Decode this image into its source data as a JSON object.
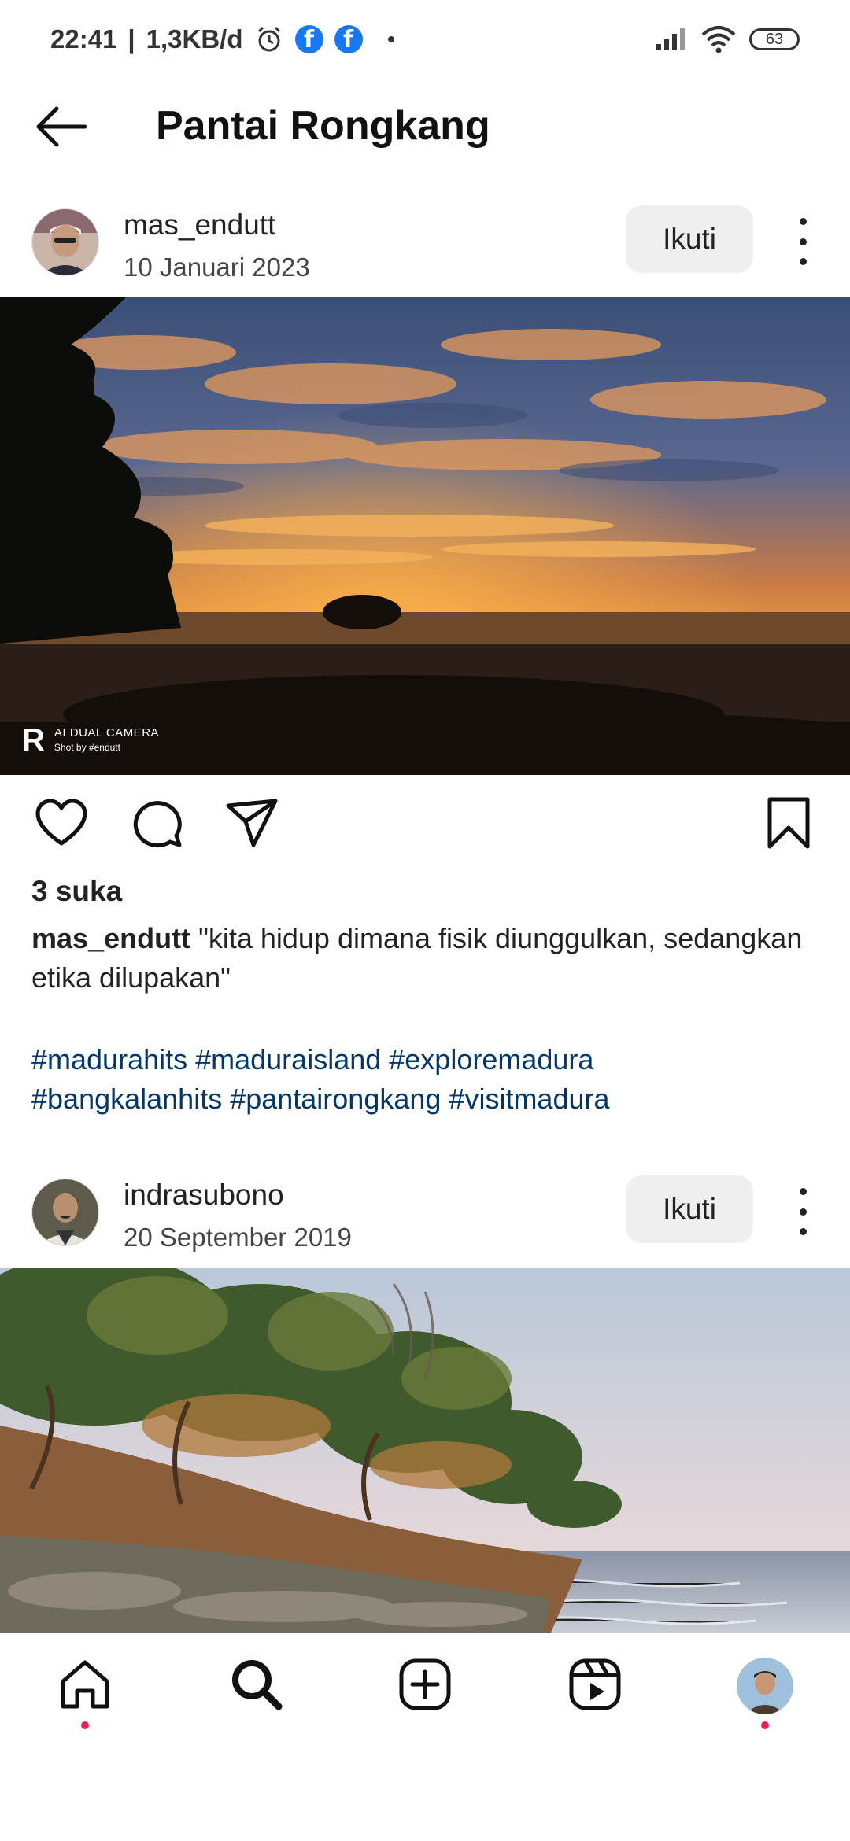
{
  "status_bar": {
    "time": "22:41",
    "separator": "|",
    "net_speed": "1,3KB/d",
    "battery": "63",
    "icons": [
      "alarm-icon",
      "facebook-icon",
      "facebook-icon",
      "dot-icon",
      "signal-icon",
      "wifi-icon",
      "battery-icon"
    ]
  },
  "header": {
    "title": "Pantai Rongkang",
    "back_icon": "arrow-left-icon"
  },
  "posts": [
    {
      "username": "mas_endutt",
      "date": "10 Januari 2023",
      "follow_label": "Ikuti",
      "photo_watermark_brand": "AI DUAL CAMERA",
      "photo_watermark_credit": "Shot by #endutt",
      "likes": "3 suka",
      "caption_user": "mas_endutt",
      "caption_text": "\"kita hidup dimana fisik diunggulkan, sedangkan etika dilupakan\"",
      "hashtags_line1": "#madurahits #maduraisland #exploremadura",
      "hashtags_line2": "#bangkalanhits #pantairongkang #visitmadura"
    },
    {
      "username": "indrasubono",
      "date": "20 September 2019",
      "follow_label": "Ikuti"
    }
  ],
  "action_icons": [
    "heart-icon",
    "comment-icon",
    "share-icon",
    "bookmark-icon"
  ],
  "bottom_nav": [
    "home-icon",
    "search-icon",
    "create-icon",
    "reels-icon",
    "profile-avatar"
  ],
  "colors": {
    "hashtag": "#00376b",
    "follow_bg": "#efefef",
    "notification_dot": "#ee1d52",
    "facebook": "#1877F2"
  }
}
